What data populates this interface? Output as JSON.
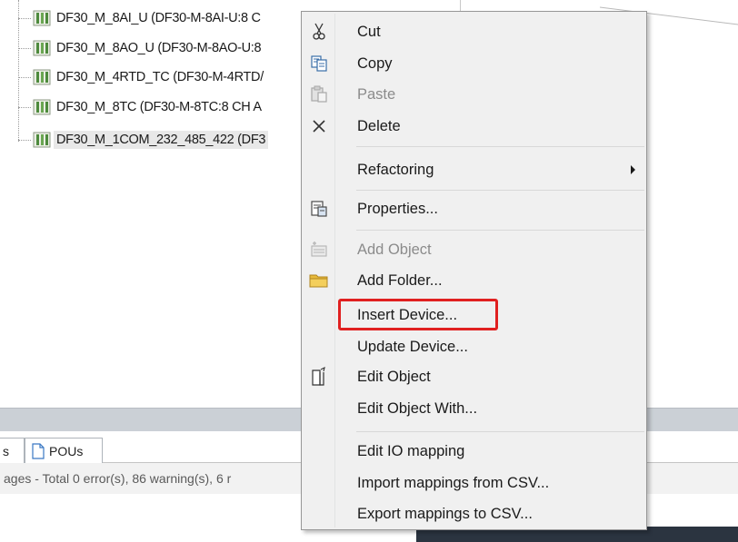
{
  "tree": {
    "items": [
      {
        "label": "DF30_M_8AI_U (DF30-M-8AI-U:8 C"
      },
      {
        "label": "DF30_M_8AO_U (DF30-M-8AO-U:8"
      },
      {
        "label": "DF30_M_4RTD_TC (DF30-M-4RTD/"
      },
      {
        "label": "DF30_M_8TC (DF30-M-8TC:8 CH A"
      },
      {
        "label": "DF30_M_1COM_232_485_422 (DF3"
      }
    ]
  },
  "bottom_panel": {
    "tabs": [
      {
        "label": "s"
      },
      {
        "label": "POUs"
      }
    ],
    "status_text": "ages - Total 0 error(s), 86 warning(s), 6 r"
  },
  "context_menu": {
    "items": [
      {
        "label": "Cut",
        "icon": "scissors-icon",
        "enabled": true
      },
      {
        "label": "Copy",
        "icon": "copy-icon",
        "enabled": true
      },
      {
        "label": "Paste",
        "icon": "paste-icon",
        "enabled": false
      },
      {
        "label": "Delete",
        "icon": "delete-x-icon",
        "enabled": true
      },
      {
        "label": "Refactoring",
        "icon": "",
        "enabled": true,
        "submenu": true
      },
      {
        "label": "Properties...",
        "icon": "properties-icon",
        "enabled": true
      },
      {
        "label": "Add Object",
        "icon": "add-object-icon",
        "enabled": false
      },
      {
        "label": "Add Folder...",
        "icon": "folder-icon",
        "enabled": true
      },
      {
        "label": "Insert Device...",
        "icon": "",
        "enabled": true,
        "highlighted": true
      },
      {
        "label": "Update Device...",
        "icon": "",
        "enabled": true
      },
      {
        "label": "Edit Object",
        "icon": "edit-object-icon",
        "enabled": true
      },
      {
        "label": "Edit Object With...",
        "icon": "",
        "enabled": true
      },
      {
        "label": "Edit IO mapping",
        "icon": "",
        "enabled": true
      },
      {
        "label": "Import mappings from CSV...",
        "icon": "",
        "enabled": true
      },
      {
        "label": "Export mappings to CSV...",
        "icon": "",
        "enabled": true
      }
    ],
    "highlight_color": "#e02020"
  }
}
